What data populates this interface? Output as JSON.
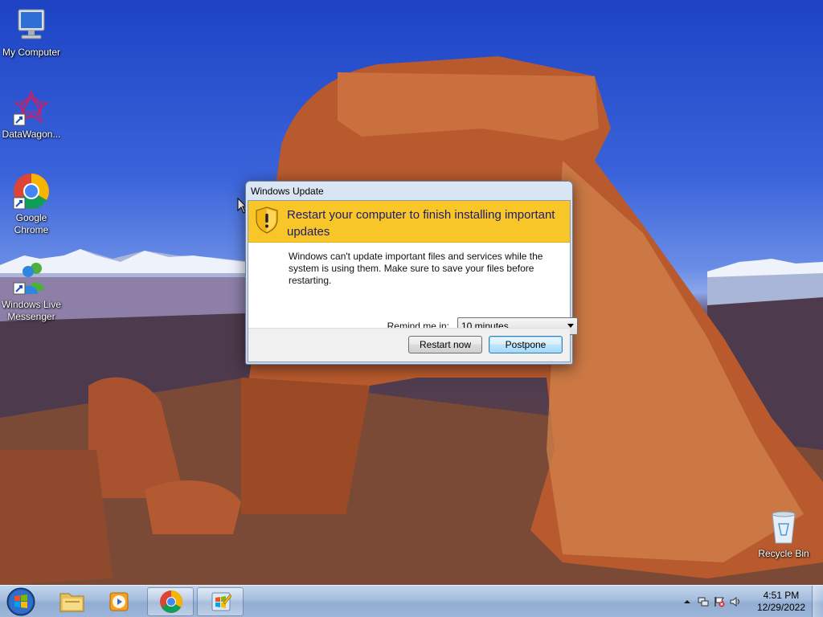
{
  "desktop": {
    "icons": [
      {
        "label": "My Computer",
        "icon": "computer-icon"
      },
      {
        "label": "DataWagon...",
        "icon": "datawagon-icon"
      },
      {
        "label": "Google Chrome",
        "icon": "chrome-icon"
      },
      {
        "label": "Windows Live Messenger",
        "icon": "messenger-icon"
      },
      {
        "label": "Recycle Bin",
        "icon": "recycle-bin-icon"
      }
    ]
  },
  "dialog": {
    "title": "Windows Update",
    "heading": "Restart your computer to finish installing important updates",
    "message": "Windows can't update important files and services while the system is using them. Make sure to save your files before restarting.",
    "remind_label": "Remind me in:",
    "remind_value": "10 minutes",
    "restart_button": "Restart now",
    "postpone_button": "Postpone",
    "banner_color": "#f9c62a"
  },
  "taskbar": {
    "pinned": [
      {
        "name": "start-button",
        "icon": "windows-orb-icon"
      },
      {
        "name": "explorer",
        "icon": "folder-icon"
      },
      {
        "name": "media-player",
        "icon": "media-player-icon"
      },
      {
        "name": "chrome",
        "icon": "chrome-icon"
      },
      {
        "name": "windows-update",
        "icon": "windows-update-icon"
      }
    ],
    "tray": {
      "time": "4:51 PM",
      "date": "12/29/2022",
      "icons": [
        "show-hidden-icons-arrow",
        "network-icon",
        "action-center-flag-icon",
        "volume-icon"
      ]
    }
  }
}
